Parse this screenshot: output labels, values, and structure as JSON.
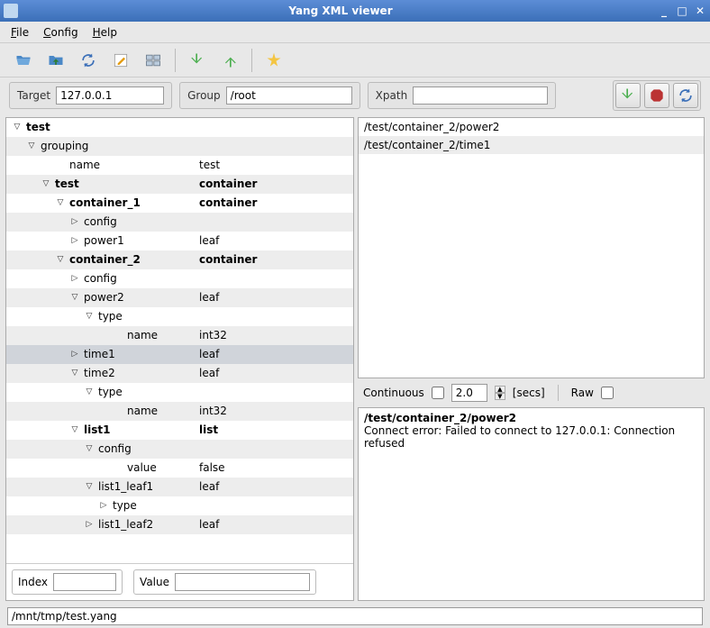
{
  "window": {
    "title": "Yang XML viewer"
  },
  "menu": {
    "file": "File",
    "config": "Config",
    "help": "Help"
  },
  "params": {
    "target_label": "Target",
    "target_value": "127.0.0.1",
    "group_label": "Group",
    "group_value": "/root",
    "xpath_label": "Xpath",
    "xpath_value": ""
  },
  "tree": [
    {
      "indent": 0,
      "exp": "▽",
      "name": "test",
      "value": "",
      "bold": true
    },
    {
      "indent": 1,
      "exp": "▽",
      "name": "grouping",
      "value": ""
    },
    {
      "indent": 3,
      "exp": "",
      "name": "name",
      "value": "test"
    },
    {
      "indent": 2,
      "exp": "▽",
      "name": "test",
      "value": "container",
      "bold": true
    },
    {
      "indent": 3,
      "exp": "▽",
      "name": "container_1",
      "value": "container",
      "bold": true
    },
    {
      "indent": 4,
      "exp": "▷",
      "name": "config",
      "value": ""
    },
    {
      "indent": 4,
      "exp": "▷",
      "name": "power1",
      "value": "leaf"
    },
    {
      "indent": 3,
      "exp": "▽",
      "name": "container_2",
      "value": "container",
      "bold": true
    },
    {
      "indent": 4,
      "exp": "▷",
      "name": "config",
      "value": ""
    },
    {
      "indent": 4,
      "exp": "▽",
      "name": "power2",
      "value": "leaf"
    },
    {
      "indent": 5,
      "exp": "▽",
      "name": "type",
      "value": ""
    },
    {
      "indent": 7,
      "exp": "",
      "name": "name",
      "value": "int32"
    },
    {
      "indent": 4,
      "exp": "▷",
      "name": "time1",
      "value": "leaf",
      "selected": true
    },
    {
      "indent": 4,
      "exp": "▽",
      "name": "time2",
      "value": "leaf"
    },
    {
      "indent": 5,
      "exp": "▽",
      "name": "type",
      "value": ""
    },
    {
      "indent": 7,
      "exp": "",
      "name": "name",
      "value": "int32"
    },
    {
      "indent": 4,
      "exp": "▽",
      "name": "list1",
      "value": "list",
      "bold": true
    },
    {
      "indent": 5,
      "exp": "▽",
      "name": "config",
      "value": ""
    },
    {
      "indent": 7,
      "exp": "",
      "name": "value",
      "value": "false"
    },
    {
      "indent": 5,
      "exp": "▽",
      "name": "list1_leaf1",
      "value": "leaf"
    },
    {
      "indent": 6,
      "exp": "▷",
      "name": "type",
      "value": ""
    },
    {
      "indent": 5,
      "exp": "▷",
      "name": "list1_leaf2",
      "value": "leaf"
    }
  ],
  "bottom": {
    "index_label": "Index",
    "index_value": "",
    "value_label": "Value",
    "value_value": ""
  },
  "xpaths": [
    "/test/container_2/power2",
    "/test/container_2/time1"
  ],
  "continuous": {
    "label": "Continuous",
    "checked": false,
    "interval": "2.0",
    "unit": "[secs]",
    "raw_label": "Raw",
    "raw_checked": false
  },
  "log": {
    "path": "/test/container_2/power2",
    "msg": "Connect error: Failed to connect to 127.0.0.1: Connection refused"
  },
  "status": {
    "path": "/mnt/tmp/test.yang"
  }
}
